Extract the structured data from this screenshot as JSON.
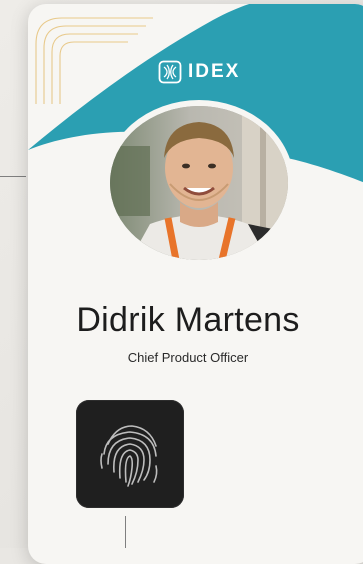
{
  "brand": {
    "name": "IDEX",
    "accent_color": "#2b9fb2",
    "logo_icon": "idex-logo-icon"
  },
  "person": {
    "name": "Didrik Martens",
    "title": "Chief Product Officer",
    "photo": "profile-photo"
  },
  "sensor": {
    "icon": "fingerprint-icon"
  }
}
